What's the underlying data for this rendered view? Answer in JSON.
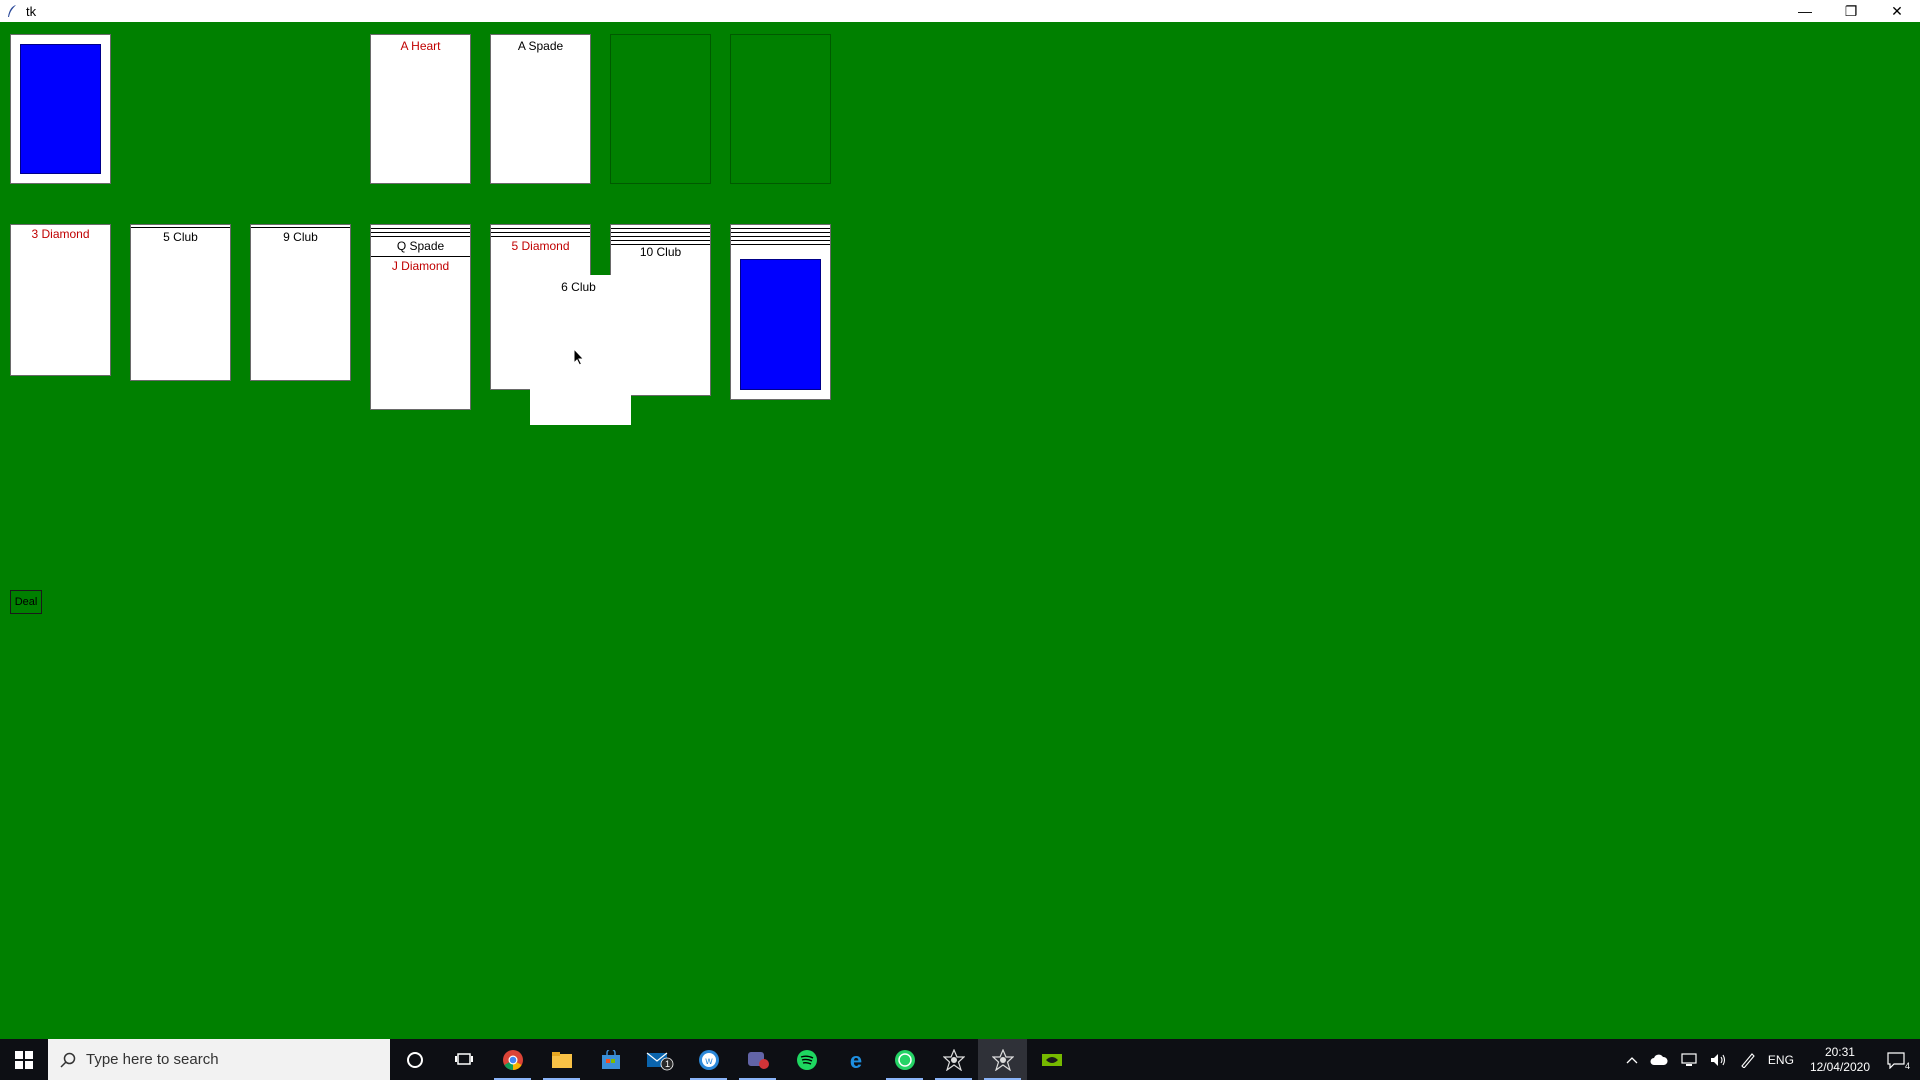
{
  "window": {
    "title": "tk",
    "minimize": "—",
    "restore": "❐",
    "close": "✕"
  },
  "foundations": [
    {
      "label": "A  Heart",
      "color": "#c00000"
    },
    {
      "label": "A  Spade",
      "color": "#000000"
    }
  ],
  "tableau": {
    "col1": "3  Diamond",
    "col2": "5  Club",
    "col3": "9  Club",
    "col4_hidden": "Q  Spade",
    "col4_top": "J  Diamond",
    "col5": "5  Diamond",
    "col6": "10  Club",
    "dragging": "6  Club"
  },
  "deal_button": "Deal",
  "taskbar": {
    "search_placeholder": "Type here to search",
    "mail_badge": "1",
    "language": "ENG",
    "time": "20:31",
    "date": "12/04/2020",
    "notification_count": "4"
  },
  "colors": {
    "table": "#008000",
    "card_back": "#0000ff",
    "red_suit": "#c00000"
  }
}
